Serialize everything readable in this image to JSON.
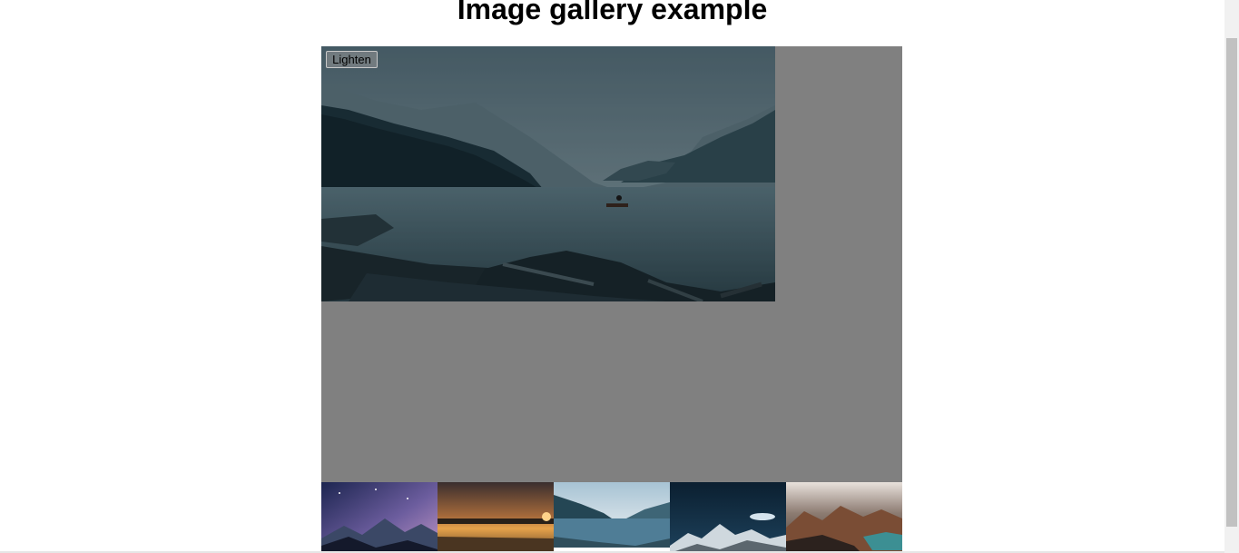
{
  "page": {
    "title": "Image gallery example"
  },
  "gallery": {
    "button_label": "Lighten",
    "main_image": "lake-kayak",
    "thumbnails": [
      {
        "name": "thumb-milky-way-mountains"
      },
      {
        "name": "thumb-sunset-lake"
      },
      {
        "name": "thumb-lake-kayak"
      },
      {
        "name": "thumb-snowy-peaks"
      },
      {
        "name": "thumb-cloudy-mountains"
      }
    ]
  },
  "colors": {
    "display_background": "#808080",
    "darken_overlay": "rgba(0,0,0,0.2)"
  }
}
